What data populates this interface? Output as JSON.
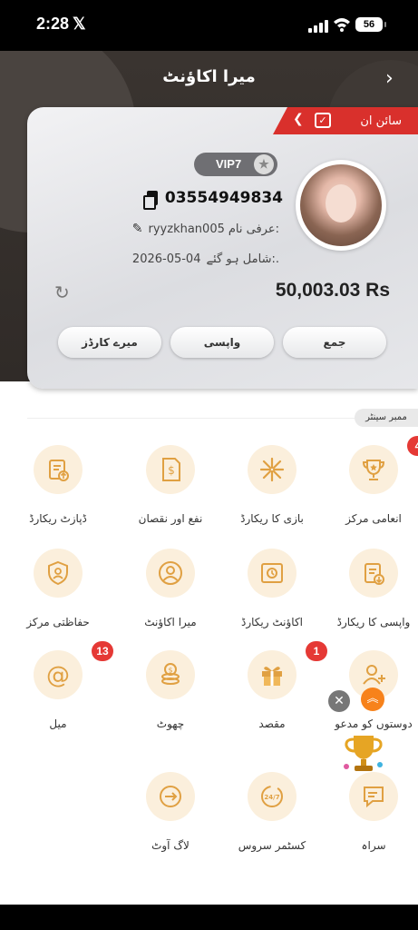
{
  "status_bar": {
    "time": "2:28",
    "x_logo": "𝕏",
    "battery": "56"
  },
  "header": {
    "title": "میرا اکاؤنٹ",
    "back": "›"
  },
  "card": {
    "signin_label": "سائن ان",
    "vip": "VIP7",
    "phone": "03554949834",
    "nickname_label": "عرفی نام:",
    "nickname": "ryyzkhan005",
    "joined_label": "شامل ہو گئے:.",
    "joined": "2026-05-04",
    "balance": "50,003.03 Rs",
    "buttons": {
      "deposit": "جمع",
      "withdraw": "واپسی",
      "cards": "میرے کارڈز"
    }
  },
  "member_center": {
    "tag": "ممبر سینٹر",
    "items": [
      {
        "label": "انعامی مرکز",
        "icon": "trophy-icon",
        "badge": "4"
      },
      {
        "label": "بازی کا ریکارڈ",
        "icon": "game-record-icon",
        "badge": ""
      },
      {
        "label": "نفع اور نقصان",
        "icon": "profit-loss-icon",
        "badge": ""
      },
      {
        "label": "ڈپازٹ ریکارڈ",
        "icon": "deposit-record-icon",
        "badge": ""
      },
      {
        "label": "واپسی کا ریکارڈ",
        "icon": "withdraw-record-icon",
        "badge": ""
      },
      {
        "label": "اکاؤنٹ ریکارڈ",
        "icon": "account-record-icon",
        "badge": ""
      },
      {
        "label": "میرا اکاؤنٹ",
        "icon": "user-icon",
        "badge": ""
      },
      {
        "label": "حفاظتی مرکز",
        "icon": "shield-icon",
        "badge": ""
      },
      {
        "label": "دوستوں کو مدعو",
        "icon": "invite-friends-icon",
        "badge": ""
      },
      {
        "label": "مقصد",
        "icon": "gift-icon",
        "badge": "1"
      },
      {
        "label": "چھوٹ",
        "icon": "coins-icon",
        "badge": ""
      },
      {
        "label": "میل",
        "icon": "mail-icon",
        "badge": "13"
      },
      {
        "label": "سراہ",
        "icon": "feedback-icon",
        "badge": ""
      },
      {
        "label": "کسٹمر سروس",
        "icon": "support-24-7-icon",
        "badge": ""
      },
      {
        "label": "لاگ آوٹ",
        "icon": "logout-icon",
        "badge": ""
      }
    ]
  },
  "floating": {
    "close": "✕",
    "up": "︽"
  },
  "colors": {
    "accent_gold": "#e0a042",
    "badge_red": "#e53935",
    "ribbon_red": "#d9302c",
    "icon_bg": "#fbefdc"
  }
}
